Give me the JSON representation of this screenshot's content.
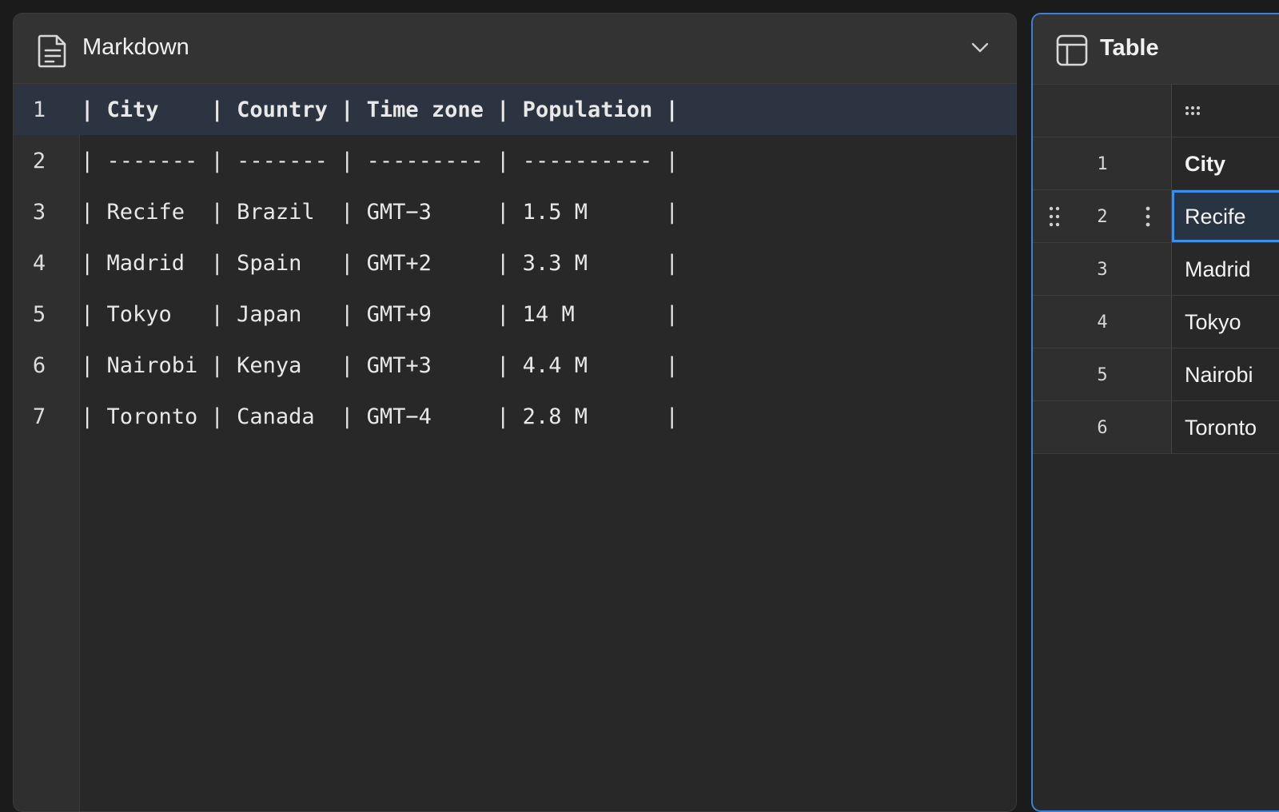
{
  "markdown_panel": {
    "title": "Markdown",
    "icon": "document-icon",
    "lines": [
      {
        "num": "1",
        "text": "| City    | Country | Time zone | Population |"
      },
      {
        "num": "2",
        "text": "| ------- | ------- | --------- | ---------- |"
      },
      {
        "num": "3",
        "text": "| Recife  | Brazil  | GMT−3     | 1.5 M      |"
      },
      {
        "num": "4",
        "text": "| Madrid  | Spain   | GMT+2     | 3.3 M      |"
      },
      {
        "num": "5",
        "text": "| Tokyo   | Japan   | GMT+9     | 14 M       |"
      },
      {
        "num": "6",
        "text": "| Nairobi | Kenya   | GMT+3     | 4.4 M      |"
      },
      {
        "num": "7",
        "text": "| Toronto | Canada  | GMT−4     | 2.8 M      |"
      }
    ]
  },
  "table_panel": {
    "title": "Table",
    "icon": "table-icon",
    "rows": [
      {
        "num": "1",
        "cell": "City"
      },
      {
        "num": "2",
        "cell": "Recife"
      },
      {
        "num": "3",
        "cell": "Madrid"
      },
      {
        "num": "4",
        "cell": "Tokyo"
      },
      {
        "num": "5",
        "cell": "Nairobi"
      },
      {
        "num": "6",
        "cell": "Toronto"
      }
    ]
  },
  "colors": {
    "accent": "#3b82d6",
    "active_line": "#2b3440",
    "panel_bg": "#282828",
    "header_bg": "#333333"
  }
}
